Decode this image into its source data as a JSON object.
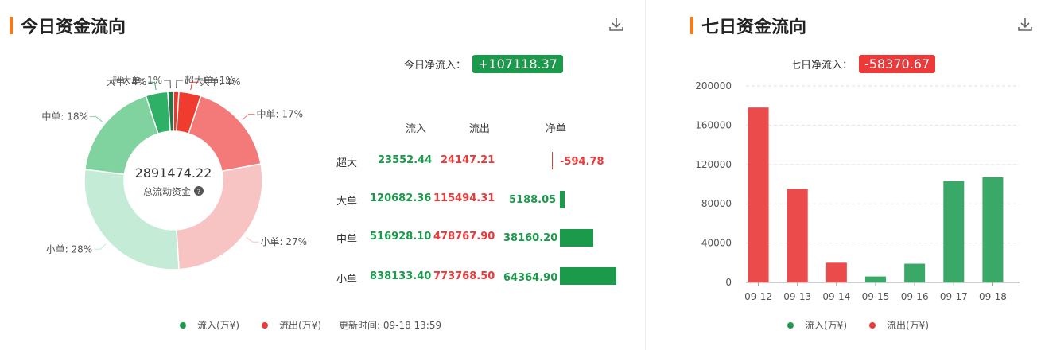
{
  "left": {
    "title": "今日资金流向",
    "net_label": "今日净流入：",
    "net_value": "+107118.37",
    "donut": {
      "center_value": "2891474.22",
      "center_label": "总流动资金"
    },
    "table": {
      "headers": [
        "流入",
        "流出",
        "净单"
      ],
      "rows": [
        {
          "label": "超大",
          "inflow": "23552.44",
          "outflow": "24147.21",
          "net": "-594.78"
        },
        {
          "label": "大单",
          "inflow": "120682.36",
          "outflow": "115494.31",
          "net": "5188.05"
        },
        {
          "label": "中单",
          "inflow": "516928.10",
          "outflow": "478767.90",
          "net": "38160.20"
        },
        {
          "label": "小单",
          "inflow": "838133.40",
          "outflow": "773768.50",
          "net": "64364.90"
        }
      ]
    },
    "legend": {
      "inflow": "流入(万¥)",
      "outflow": "流出(万¥)",
      "update_time": "更新时间: 09-18 13:59"
    }
  },
  "right": {
    "title": "七日资金流向",
    "net_label": "七日净流入：",
    "net_value": "-58370.67",
    "legend": {
      "inflow": "流入(万¥)",
      "outflow": "流出(万¥)"
    }
  },
  "colors": {
    "green": "#1a9a4a",
    "red": "#ec3a3a",
    "accent": "#f07c1b"
  },
  "chart_data": [
    {
      "type": "pie",
      "center_value": "2891474.22",
      "center_label": "总流动资金",
      "slices": [
        {
          "label": "超大单: 1%",
          "value": 1,
          "color": "#e8392f"
        },
        {
          "label": "大单: 4%",
          "value": 4,
          "color": "#f03c2e"
        },
        {
          "label": "中单: 17%",
          "value": 17,
          "color": "#f37a78"
        },
        {
          "label": "小单: 27%",
          "value": 27,
          "color": "#f8c4c3"
        },
        {
          "label": "小单: 28%",
          "value": 28,
          "color": "#c4ebd6"
        },
        {
          "label": "中单: 18%",
          "value": 18,
          "color": "#80d39f"
        },
        {
          "label": "大单: 4%",
          "value": 4,
          "color": "#2fb067"
        },
        {
          "label": "超大单: 1%",
          "value": 1,
          "color": "#1f7a45"
        }
      ]
    },
    {
      "type": "bar",
      "categories": [
        "09-12",
        "09-13",
        "09-14",
        "09-15",
        "09-16",
        "09-17",
        "09-18"
      ],
      "values": [
        178000,
        95000,
        20000,
        6000,
        19000,
        103000,
        107000
      ],
      "colors": [
        "#ec4b4b",
        "#ec4b4b",
        "#ec4b4b",
        "#3aa866",
        "#3aa866",
        "#3aa866",
        "#3aa866"
      ],
      "ylim": [
        0,
        200000
      ],
      "yticks": [
        "0",
        "40000",
        "80000",
        "120000",
        "160000",
        "200000"
      ],
      "grid": true,
      "legend": [
        "流入(万¥)",
        "流出(万¥)"
      ]
    }
  ]
}
